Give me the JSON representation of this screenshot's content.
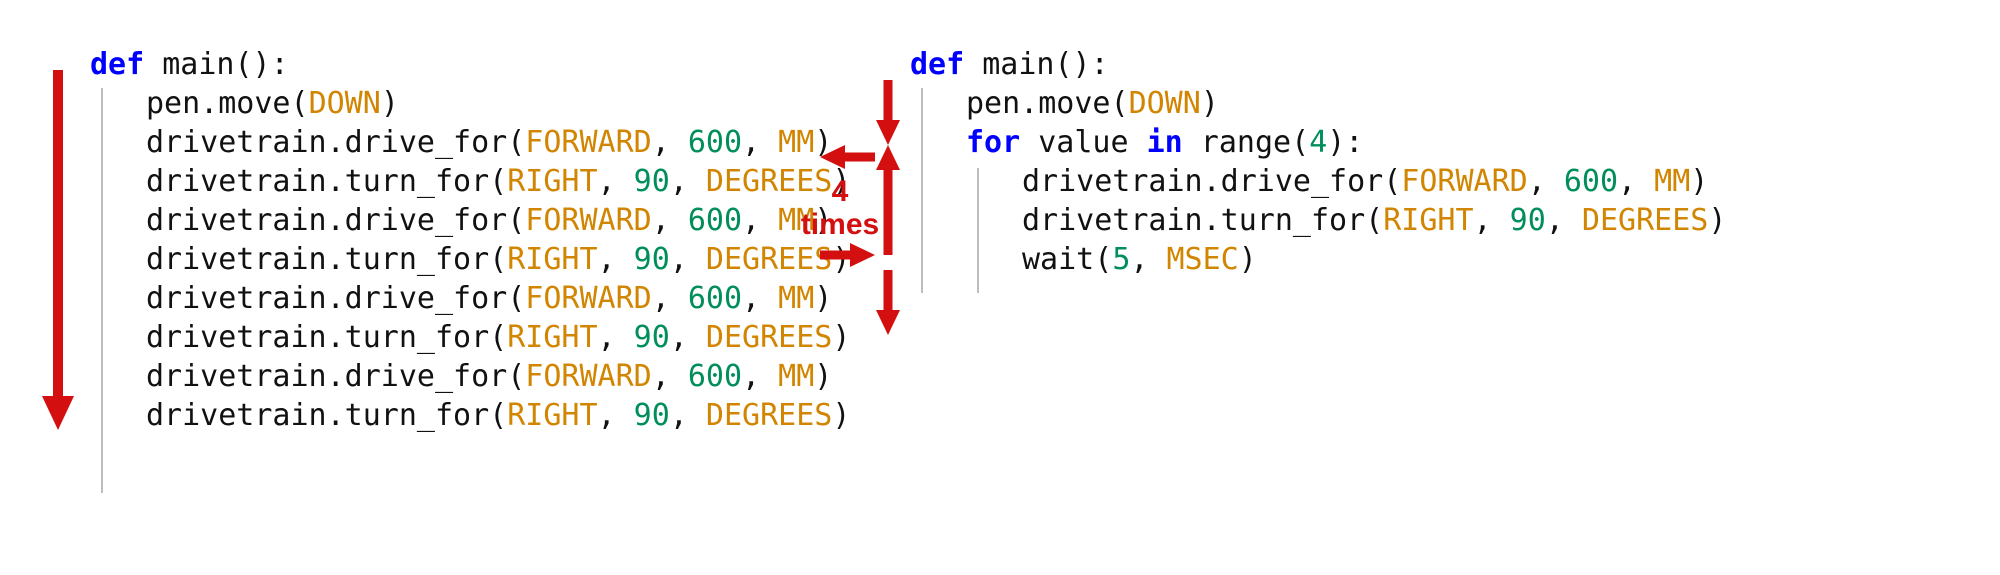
{
  "left_code": {
    "l1": {
      "def": "def",
      "name": "main",
      "parens": "():"
    },
    "l2": {
      "call": "pen.move",
      "args_a": "(",
      "c1": "DOWN",
      "args_z": ")"
    },
    "l3": {
      "call": "drivetrain.drive_for",
      "args_a": "(",
      "c1": "FORWARD",
      "sep1": ", ",
      "n1": "600",
      "sep2": ", ",
      "c2": "MM",
      "args_z": ")"
    },
    "l4": {
      "call": "drivetrain.turn_for",
      "args_a": "(",
      "c1": "RIGHT",
      "sep1": ", ",
      "n1": "90",
      "sep2": ", ",
      "c2": "DEGREES",
      "args_z": ")"
    },
    "l5": {
      "call": "drivetrain.drive_for",
      "args_a": "(",
      "c1": "FORWARD",
      "sep1": ", ",
      "n1": "600",
      "sep2": ", ",
      "c2": "MM",
      "args_z": ")"
    },
    "l6": {
      "call": "drivetrain.turn_for",
      "args_a": "(",
      "c1": "RIGHT",
      "sep1": ", ",
      "n1": "90",
      "sep2": ", ",
      "c2": "DEGREES",
      "args_z": ")"
    },
    "l7": {
      "call": "drivetrain.drive_for",
      "args_a": "(",
      "c1": "FORWARD",
      "sep1": ", ",
      "n1": "600",
      "sep2": ", ",
      "c2": "MM",
      "args_z": ")"
    },
    "l8": {
      "call": "drivetrain.turn_for",
      "args_a": "(",
      "c1": "RIGHT",
      "sep1": ", ",
      "n1": "90",
      "sep2": ", ",
      "c2": "DEGREES",
      "args_z": ")"
    },
    "l9": {
      "call": "drivetrain.drive_for",
      "args_a": "(",
      "c1": "FORWARD",
      "sep1": ", ",
      "n1": "600",
      "sep2": ", ",
      "c2": "MM",
      "args_z": ")"
    },
    "l10": {
      "call": "drivetrain.turn_for",
      "args_a": "(",
      "c1": "RIGHT",
      "sep1": ", ",
      "n1": "90",
      "sep2": ", ",
      "c2": "DEGREES",
      "args_z": ")"
    }
  },
  "right_code": {
    "l1": {
      "def": "def",
      "name": "main",
      "parens": "():"
    },
    "l2": {
      "call": "pen.move",
      "args_a": "(",
      "c1": "DOWN",
      "args_z": ")"
    },
    "l3": {
      "for": "for",
      "var": " value ",
      "in": "in",
      "rng": " range",
      "args_a": "(",
      "n1": "4",
      "args_z": "):"
    },
    "l4": {
      "call": "drivetrain.drive_for",
      "args_a": "(",
      "c1": "FORWARD",
      "sep1": ", ",
      "n1": "600",
      "sep2": ", ",
      "c2": "MM",
      "args_z": ")"
    },
    "l5": {
      "call": "drivetrain.turn_for",
      "args_a": "(",
      "c1": "RIGHT",
      "sep1": ", ",
      "n1": "90",
      "sep2": ", ",
      "c2": "DEGREES",
      "args_z": ")"
    },
    "l6": {
      "call": "wait",
      "args_a": "(",
      "n1": "5",
      "sep1": ", ",
      "c1": "MSEC",
      "args_z": ")"
    }
  },
  "annotation": {
    "loop_label_line1": "4",
    "loop_label_line2": "times"
  },
  "colors": {
    "keyword": "#0000ff",
    "constant": "#d18500",
    "number": "#008f5b",
    "text": "#111111",
    "arrow": "#d30f0f",
    "guide": "#bdbdbd"
  }
}
